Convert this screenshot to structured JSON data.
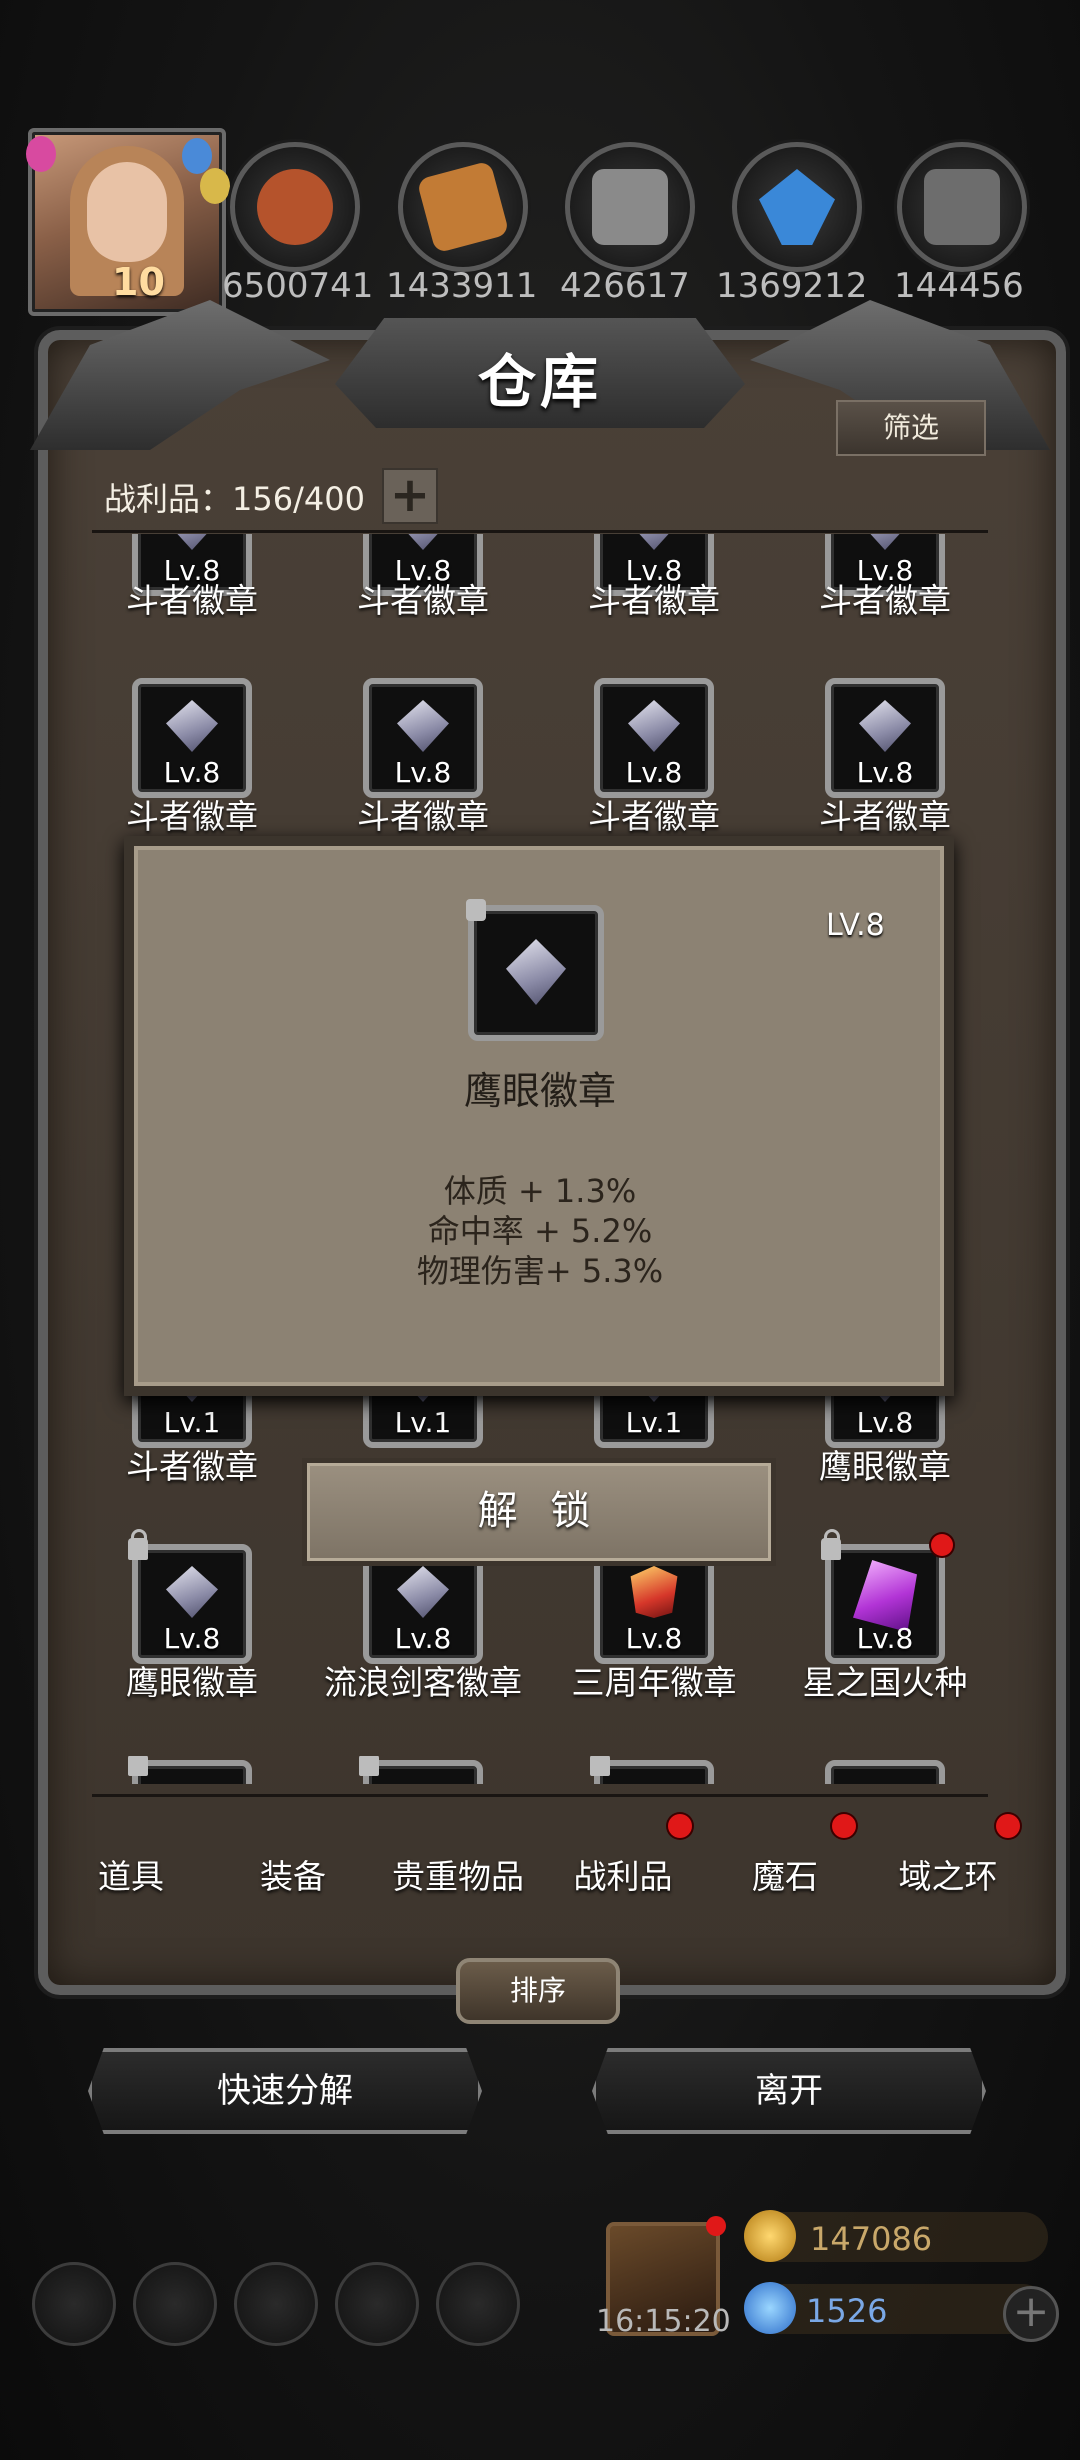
{
  "top_bar": {
    "avatar_level": "10",
    "resources": [
      {
        "name": "meat",
        "value": "6500741",
        "color": "#b5532c"
      },
      {
        "name": "wood",
        "value": "1433911",
        "color": "#c27b35"
      },
      {
        "name": "stone",
        "value": "426617",
        "color": "#8a8a8a"
      },
      {
        "name": "crystal",
        "value": "1369212",
        "color": "#3a88d8"
      },
      {
        "name": "iron",
        "value": "144456",
        "color": "#6d6d6d"
      }
    ]
  },
  "warehouse": {
    "title": "仓库",
    "filter_label": "筛选",
    "loot_count": "战利品：156/400",
    "plus_label": "+"
  },
  "grid": {
    "row1": [
      {
        "lv": "Lv.8",
        "name": "斗者徽章"
      },
      {
        "lv": "Lv.8",
        "name": "斗者徽章"
      },
      {
        "lv": "Lv.8",
        "name": "斗者徽章"
      },
      {
        "lv": "Lv.8",
        "name": "斗者徽章"
      }
    ],
    "row2": [
      {
        "lv": "Lv.8",
        "name": "斗者徽章"
      },
      {
        "lv": "Lv.8",
        "name": "斗者徽章"
      },
      {
        "lv": "Lv.8",
        "name": "斗者徽章"
      },
      {
        "lv": "Lv.8",
        "name": "斗者徽章"
      }
    ],
    "row5": [
      {
        "lv": "Lv.1",
        "name": "斗者徽章"
      },
      {
        "lv": "Lv.1",
        "name": ""
      },
      {
        "lv": "Lv.1",
        "name": ""
      },
      {
        "lv": "Lv.8",
        "name": "鹰眼徽章"
      }
    ],
    "row6": [
      {
        "lv": "Lv.8",
        "name": "鹰眼徽章"
      },
      {
        "lv": "Lv.8",
        "name": "流浪剑客徽章"
      },
      {
        "lv": "Lv.8",
        "name": "三周年徽章"
      },
      {
        "lv": "Lv.8",
        "name": "星之国火种"
      }
    ]
  },
  "popup": {
    "level": "LV.8",
    "name": "鹰眼徽章",
    "stats": [
      "体质 + 1.3%",
      "命中率 + 5.2%",
      "物理伤害+ 5.3%"
    ],
    "unlock_label": "解 锁"
  },
  "tabs": [
    "道具",
    "装备",
    "贵重物品",
    "战利品",
    "魔石",
    "域之环"
  ],
  "buttons": {
    "sort": "排序",
    "quick_decompose": "快速分解",
    "leave": "离开"
  },
  "bottom": {
    "timer": "16:15:20",
    "gold": "147086",
    "gems": "1526"
  }
}
